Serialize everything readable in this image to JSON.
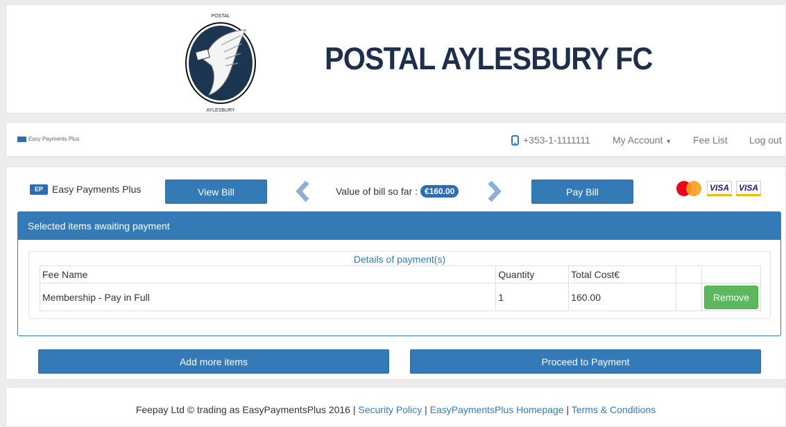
{
  "header": {
    "logo_top_text": "POSTAL",
    "logo_bottom_text": "AYLESBURY",
    "club_name": "POSTAL AYLESBURY FC"
  },
  "navbar": {
    "brand": "Easy Payments Plus",
    "phone": "+353-1-1111111",
    "my_account": "My Account",
    "fee_list": "Fee List",
    "log_out": "Log out"
  },
  "toolbar": {
    "brand": "Easy Payments Plus",
    "brand_badge": "EP",
    "view_bill": "View Bill",
    "bill_value_label": "Value of bill so far :",
    "bill_value_amount": "€160.00",
    "pay_bill": "Pay Bill",
    "card_logos": [
      "MasterCard",
      "VISA",
      "VISA"
    ]
  },
  "payment_panel": {
    "heading": "Selected items awaiting payment",
    "details_title": "Details of payment(s)",
    "columns": [
      "Fee Name",
      "Quantity",
      "Total Cost€",
      ""
    ],
    "rows": [
      {
        "fee_name": "Membership - Pay in Full",
        "quantity": "1",
        "total_cost": "160.00",
        "action": "Remove"
      }
    ]
  },
  "actions": {
    "add_more": "Add more items",
    "proceed": "Proceed to Payment"
  },
  "footer": {
    "text": "Feepay Ltd © trading as EasyPaymentsPlus 2016 |",
    "sep": "|",
    "security_policy": "Security Policy",
    "homepage": "EasyPaymentsPlus Homepage",
    "terms": "Terms & Conditions"
  },
  "colors": {
    "primary": "#337ab7",
    "success": "#5cb85c",
    "title": "#1d2f4a"
  }
}
